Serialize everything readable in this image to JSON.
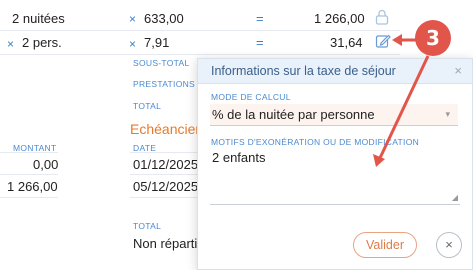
{
  "rows": [
    {
      "qty": "2 nuitées",
      "times": "×",
      "price": "633,00",
      "equals": "=",
      "total": "1 266,00",
      "icon": "lock-icon"
    },
    {
      "times_pre": "×",
      "qty": "2 pers.",
      "times": "×",
      "price": "7,91",
      "equals": "=",
      "total": "31,64",
      "icon": "edit-icon"
    }
  ],
  "summary": {
    "sous_total_label": "SOUS-TOTAL",
    "prestations_label": "PRESTATIONS",
    "total_label": "TOTAL"
  },
  "echeancier": {
    "title": "Echéancier",
    "montant_label": "MONTANT",
    "date_label": "DATE",
    "rows": [
      {
        "montant": "0,00",
        "date": "01/12/2025"
      },
      {
        "montant": "1 266,00",
        "date": "05/12/2025"
      }
    ],
    "total_label": "TOTAL",
    "non_reparti": "Non réparti"
  },
  "modal": {
    "title": "Informations sur la taxe de séjour",
    "close": "×",
    "mode_label": "MODE DE CALCUL",
    "mode_value": "% de la nuitée par personne",
    "motifs_label": "MOTIFS D'EXONÉRATION OU DE MODIFICATION",
    "motifs_value": "2 enfants",
    "valider": "Valider",
    "cancel": "×"
  },
  "annotation": {
    "step": "3",
    "color": "#e2554b"
  }
}
